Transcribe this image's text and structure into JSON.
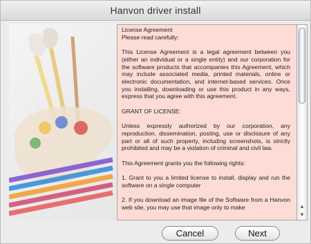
{
  "window": {
    "title": "Hanvon driver install"
  },
  "artwork": {
    "icon": "paint-palette-and-pencils-icon"
  },
  "license": {
    "text": "License Agreement\nPlease read carefully:\n\nThis License Agreement is a legal agreement between you (either an individual or a single entity) and our corporation for the software products that accompanies this Agreement, which may include associated media, printed materials, online or electronic documentation, and internet-based services. Once you installing, downloading or use this product in any ways, express that you agree with this agreement.\n\nGRANT OF LICENSE:\n\nUnless expressly authorized by our corporation, any reproduction, dissemination, posting, use or disclosure of any part or all of such property, including screenshots, is strictly prohibited and may be a violation of criminal and civil law.\n\nThis Agreement grants you the following rights:\n\n1. Grant to you a limited license to install, display and run the software on a single computer\n\n2. If you download an image file of the Software from a Hanvon web site, you may use that image only to make"
  },
  "buttons": {
    "cancel_label": "Cancel",
    "next_label": "Next"
  }
}
